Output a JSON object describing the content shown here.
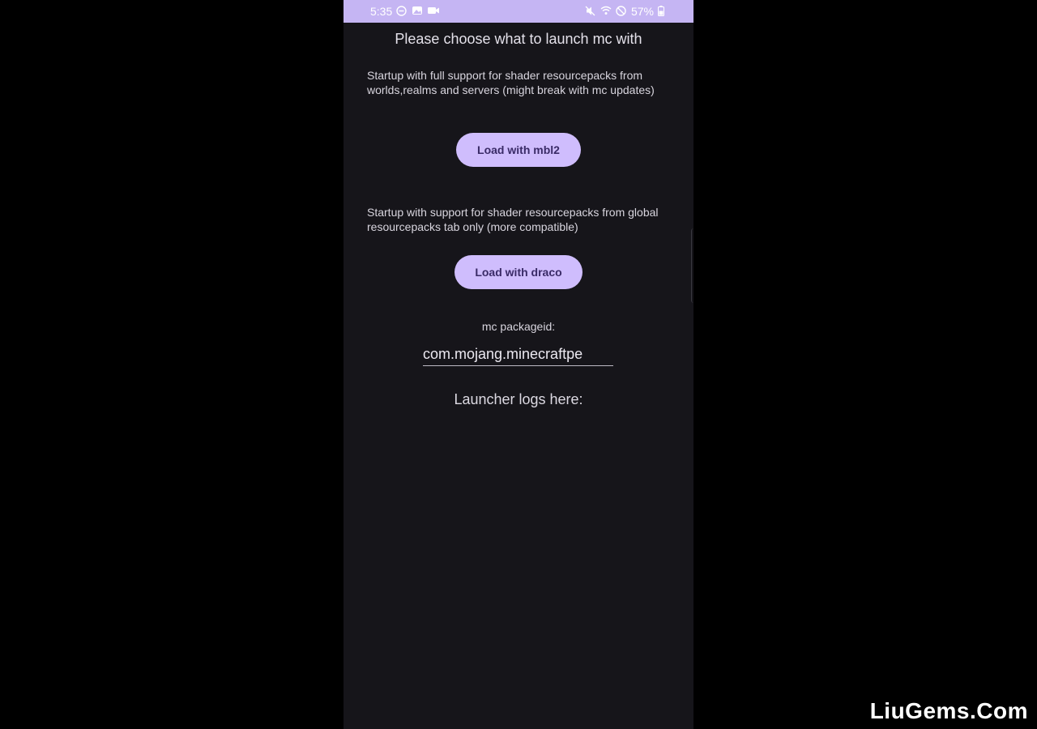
{
  "status_bar": {
    "time": "5:35",
    "battery": "57%",
    "icons_left": [
      "do-not-disturb-icon",
      "gallery-icon",
      "video-record-icon"
    ],
    "icons_right": [
      "mute-icon",
      "wifi-icon",
      "blocked-icon",
      "battery-icon"
    ],
    "background_color": "#c5b5f3"
  },
  "main": {
    "title": "Please choose what to launch mc with",
    "option_mbl2": {
      "description": "Startup with full support for shader resourcepacks from worlds,realms and servers (might break with mc updates)",
      "button_label": "Load with mbl2"
    },
    "option_draco": {
      "description": "Startup with support for shader resourcepacks from global resourcepacks tab only (more compatible)",
      "button_label": "Load with draco"
    },
    "package": {
      "label": "mc packageid:",
      "value": "com.mojang.minecraftpe"
    },
    "logs_title": "Launcher logs here:"
  },
  "colors": {
    "app_background": "#16151a",
    "button_background": "#cfbdfd",
    "button_text": "#3a2b67"
  },
  "watermark": "LiuGems.Com"
}
